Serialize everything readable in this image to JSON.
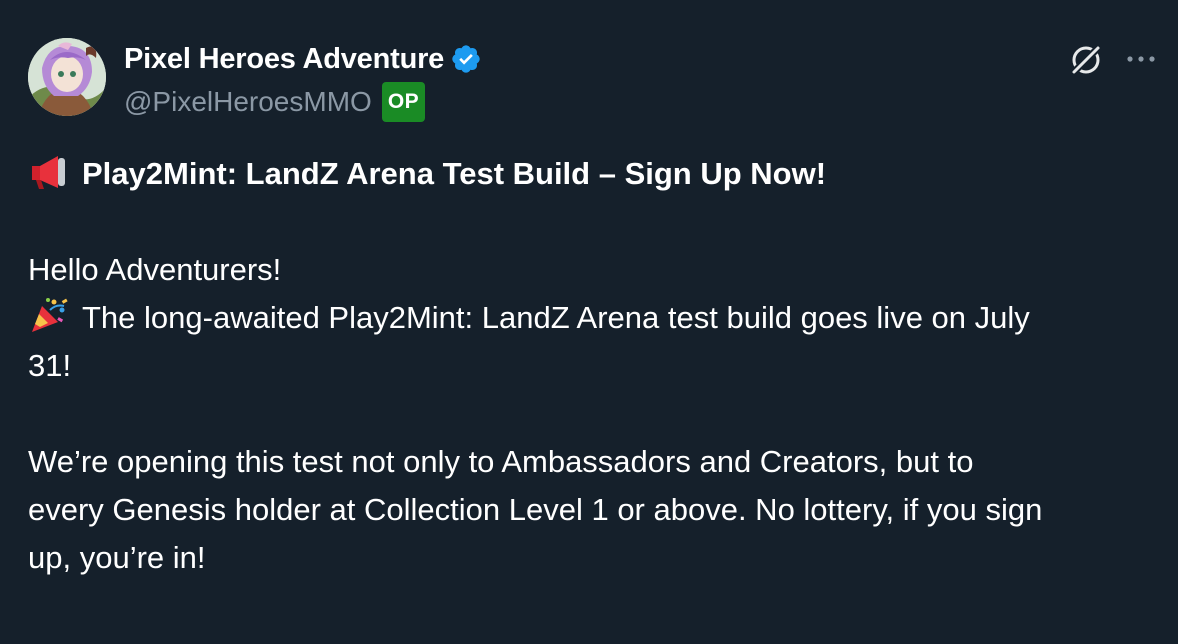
{
  "author": {
    "display_name": "Pixel Heroes Adventure",
    "handle": "@PixelHeroesMMO",
    "badge": "OP",
    "verified": true,
    "verified_color": "#1d9bf0",
    "badge_color": "#1a8b25"
  },
  "icons": {
    "grok": "grok-icon",
    "more": "more-icon",
    "megaphone": "megaphone-icon",
    "party_popper": "party-popper-icon",
    "verified": "verified-badge-icon"
  },
  "post": {
    "headline": "Play2Mint: LandZ Arena Test Build – Sign Up Now!",
    "greeting": "Hello Adventurers!",
    "line2_a": "The long-awaited Play2Mint: LandZ Arena test build goes live on July",
    "line2_b": "31!",
    "para3_a": "We’re opening this test not only to Ambassadors and Creators, but to",
    "para3_b": "every Genesis holder at Collection Level 1 or above. No lottery, if you sign",
    "para3_c": "up, you’re in!"
  },
  "colors": {
    "background": "#15202b",
    "text": "#ffffff",
    "secondary_text": "#8b98a5"
  }
}
